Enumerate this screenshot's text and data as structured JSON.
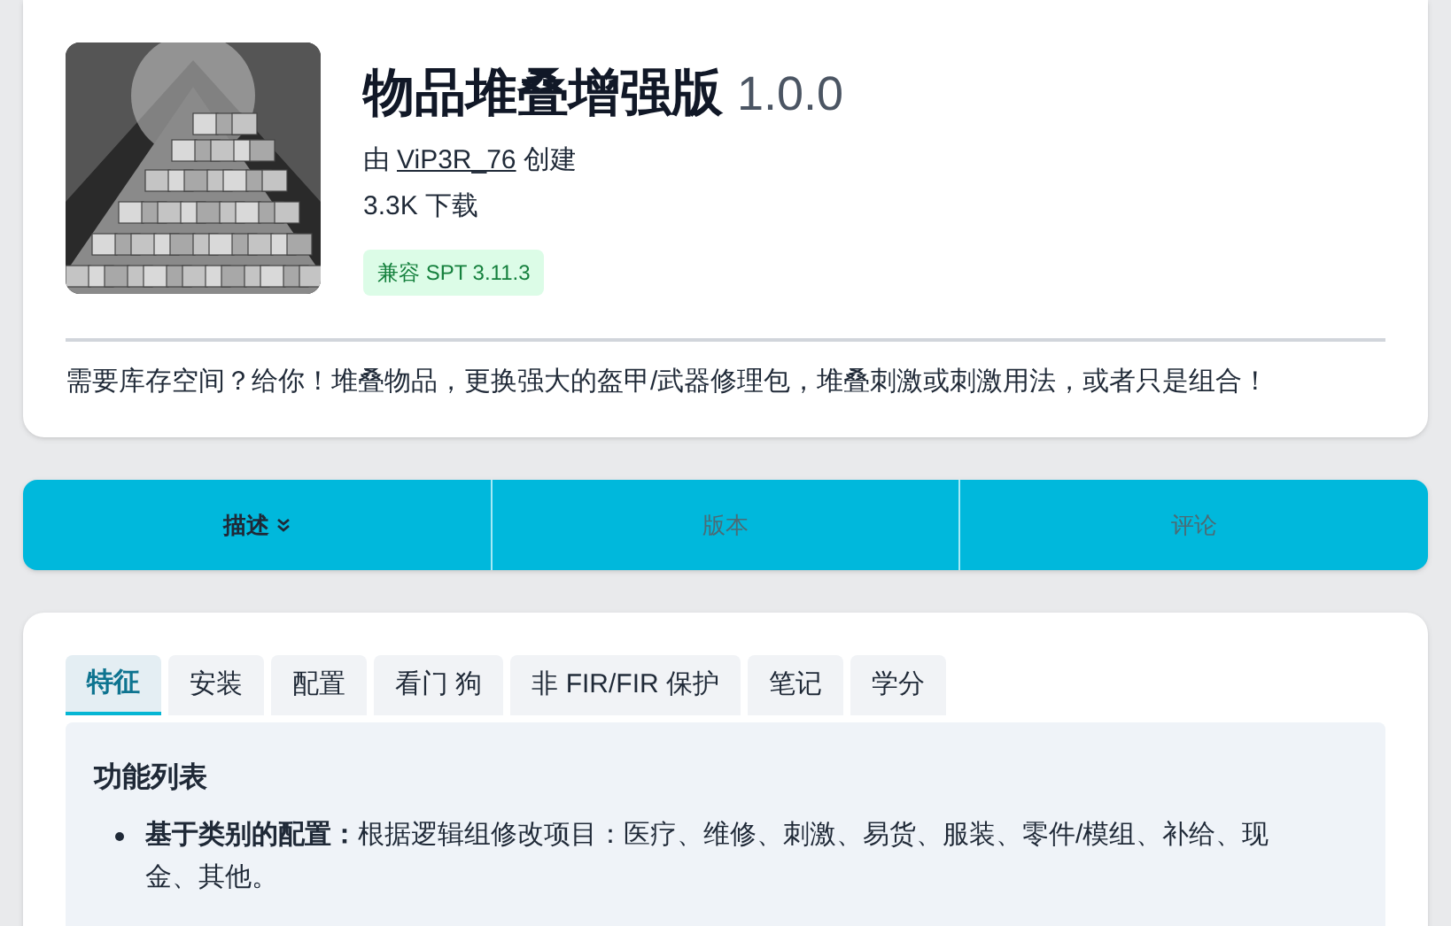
{
  "mod": {
    "title": "物品堆叠增强版",
    "version": "1.0.0",
    "author_prefix": "由",
    "author": "ViP3R_76",
    "author_suffix": "创建",
    "downloads": "3.3K 下载",
    "badge": "兼容 SPT 3.11.3",
    "summary": "需要库存空间？给你！堆叠物品，更换强大的盔甲/武器修理包，堆叠刺激或刺激用法，或者只是组合！"
  },
  "nav_tabs": [
    {
      "label": "描述",
      "selected": true,
      "kind": "dropdown"
    },
    {
      "label": "版本",
      "selected": false
    },
    {
      "label": "评论",
      "selected": false
    }
  ],
  "content_tabs": [
    {
      "label": "特征",
      "selected": true
    },
    {
      "label": "安装",
      "selected": false
    },
    {
      "label": "配置",
      "selected": false
    },
    {
      "label": "看门 狗",
      "selected": false
    },
    {
      "label": "非 FIR/FIR 保护",
      "selected": false
    },
    {
      "label": "笔记",
      "selected": false
    },
    {
      "label": "学分",
      "selected": false
    }
  ],
  "panel": {
    "heading": "功能列表",
    "items": [
      "**基于类别的配置：**根据逻辑组修改项目：医疗、维修、刺激、易货、服装、零件/模组、补给、现金、其他。"
    ]
  }
}
